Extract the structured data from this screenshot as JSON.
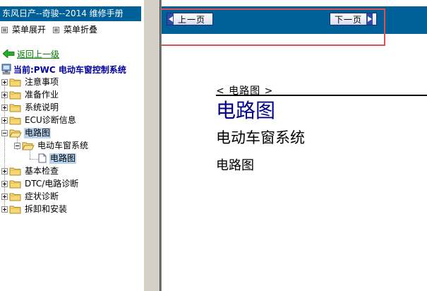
{
  "manual": {
    "title": "东风日产--奇骏--2014 维修手册"
  },
  "menu": {
    "expand_label": "菜单展开",
    "collapse_label": "菜单折叠"
  },
  "back": {
    "label": "返回上一级"
  },
  "current": {
    "label": "当前:PWC 电动车窗控制系统"
  },
  "tree": {
    "items": [
      {
        "label": "注意事项",
        "expanded": false
      },
      {
        "label": "准备作业",
        "expanded": false
      },
      {
        "label": "系统说明",
        "expanded": false
      },
      {
        "label": "ECU诊断信息",
        "expanded": false
      },
      {
        "label": "电路图",
        "expanded": true,
        "children": [
          {
            "label": "电动车窗系统",
            "expanded": true,
            "children": [
              {
                "label": "电路图",
                "selected": true
              }
            ]
          }
        ]
      },
      {
        "label": "基本检查",
        "expanded": false
      },
      {
        "label": "DTC/电路诊断",
        "expanded": false
      },
      {
        "label": "症状诊断",
        "expanded": false
      },
      {
        "label": "拆卸和安装",
        "expanded": false
      }
    ]
  },
  "nav": {
    "prev_label": "上一页",
    "next_label": "下一页"
  },
  "content": {
    "breadcrumb": "< 电路图 >",
    "heading": "电路图",
    "system": "电动车窗系统",
    "section": "电路图"
  },
  "colors": {
    "title_bar": "#00609a",
    "top_bar": "#006098",
    "heading": "#00008b",
    "highlight": "#e05050",
    "link": "#008000",
    "current": "#0000a0"
  },
  "icons": {
    "back": "green-left-arrow-icon",
    "current": "computer-icon",
    "folder": "folder-icon",
    "document": "document-icon",
    "prev": "triangle-left-icon",
    "next": "triangle-right-icon"
  }
}
